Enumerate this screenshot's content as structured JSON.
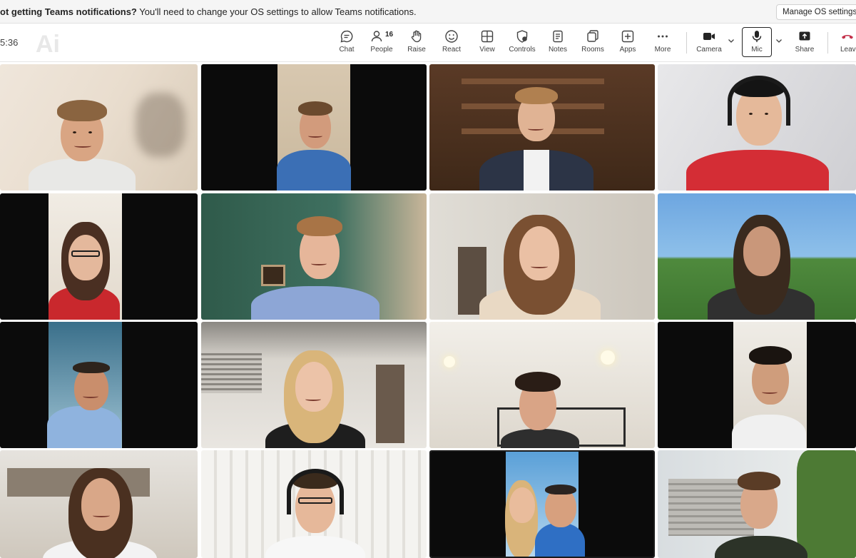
{
  "banner": {
    "bold_text": "ot getting Teams notifications?",
    "text": " You'll need to change your OS settings to allow Teams notifications.",
    "manage_button": "Manage OS settings"
  },
  "toolbar": {
    "timer": "5:36",
    "chat": "Chat",
    "people": "People",
    "people_count": "16",
    "raise": "Raise",
    "react": "React",
    "view": "View",
    "controls": "Controls",
    "notes": "Notes",
    "rooms": "Rooms",
    "apps": "Apps",
    "more": "More",
    "camera": "Camera",
    "mic": "Mic",
    "share": "Share",
    "leave": "Leav"
  },
  "colors": {
    "leave_red": "#c4314b",
    "banner_bg": "#f5f5f5"
  },
  "participants_shown": 16
}
